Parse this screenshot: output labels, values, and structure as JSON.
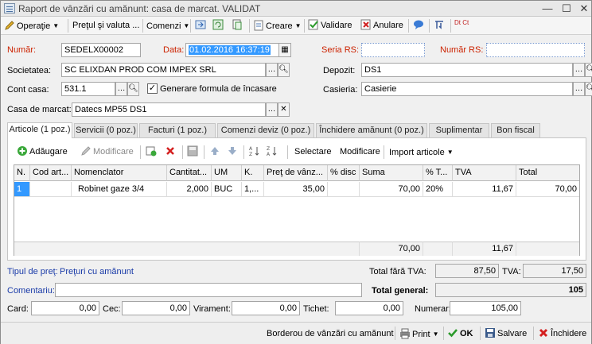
{
  "window": {
    "title": "Raport de vânzări cu amănunt: casa de marcat. VALIDAT",
    "minimize": "—",
    "maximize": "☐",
    "close": "✕"
  },
  "toolbar": {
    "operatie": "Operaţie",
    "pret_valuta": "Preţul şi valuta ...",
    "comenzi": "Comenzi",
    "creare": "Creare",
    "validare": "Validare",
    "anulare": "Anulare",
    "dtct": "Dt Ct"
  },
  "header": {
    "numar_label": "Număr:",
    "numar_value": "SEDELX00002",
    "data_label": "Data:",
    "data_value": "01.02.2016 16:37:19",
    "seria_rs_label": "Seria RS:",
    "seria_rs_value": "",
    "numar_rs_label": "Număr RS:",
    "numar_rs_value": "",
    "societatea_label": "Societatea:",
    "societatea_value": "SC ELIXDAN PROD COM IMPEX SRL",
    "depozit_label": "Depozit:",
    "depozit_value": "DS1",
    "cont_casa_label": "Cont casa:",
    "cont_casa_value": "531.1",
    "generare_label": "Generare formula de încasare",
    "generare_checked": true,
    "casieria_label": "Casieria:",
    "casieria_value": "Casierie",
    "casa_marcat_label": "Casa de marcat:",
    "casa_marcat_value": "Datecs MP55 DS1"
  },
  "tabs": [
    {
      "label": "Articole (1 poz.)",
      "active": true
    },
    {
      "label": "Servicii (0 poz.)",
      "active": false
    },
    {
      "label": "Facturi (1 poz.)",
      "active": false
    },
    {
      "label": "Comenzi deviz (0 poz.)",
      "active": false
    },
    {
      "label": "Închidere amănunt (0 poz.)",
      "active": false
    },
    {
      "label": "Suplimentar",
      "active": false
    },
    {
      "label": "Bon fiscal",
      "active": false
    }
  ],
  "grid_toolbar": {
    "adaugare": "Adăugare",
    "modificare_disabled": "Modificare",
    "selectare": "Selectare",
    "modificare": "Modificare",
    "import": "Import articole"
  },
  "grid": {
    "columns": [
      "N.",
      "Cod art...",
      "Nomenclator",
      "Cantitat...",
      "UM",
      "K.",
      "Preţ de vânz...",
      "% disc",
      "Suma",
      "% T...",
      "TVA",
      "Total"
    ],
    "rows": [
      [
        "1",
        "",
        "Robinet gaze 3/4",
        "2,000",
        "BUC",
        "1,...",
        "35,00",
        "",
        "70,00",
        "20%",
        "11,67",
        "70,00"
      ]
    ],
    "footer": {
      "suma": "70,00",
      "tva": "11,67"
    }
  },
  "summary": {
    "tip_pret_label": "Tipul de preţ:",
    "tip_pret_value": "Preţuri cu amănunt",
    "total_fara_tva_label": "Total fără TVA:",
    "total_fara_tva_value": "87,50",
    "tva_label": "TVA:",
    "tva_value": "17,50",
    "comentariu_label": "Comentariu:",
    "comentariu_value": "",
    "total_general_label": "Total general:",
    "total_general_value": "105",
    "card_label": "Card:",
    "card_value": "0,00",
    "cec_label": "Cec:",
    "cec_value": "0,00",
    "virament_label": "Virament:",
    "virament_value": "0,00",
    "tichet_label": "Tichet:",
    "tichet_value": "0,00",
    "numerar_label": "Numerar:",
    "numerar_value": "105,00"
  },
  "bottom": {
    "borderou": "Borderou de vânzări cu amănunt",
    "print": "Print",
    "ok": "OK",
    "salvare": "Salvare",
    "inchidere": "Închidere"
  },
  "colors": {
    "required_label": "#cc2200",
    "link_label": "#1a3ba8",
    "selection": "#3399ff"
  }
}
